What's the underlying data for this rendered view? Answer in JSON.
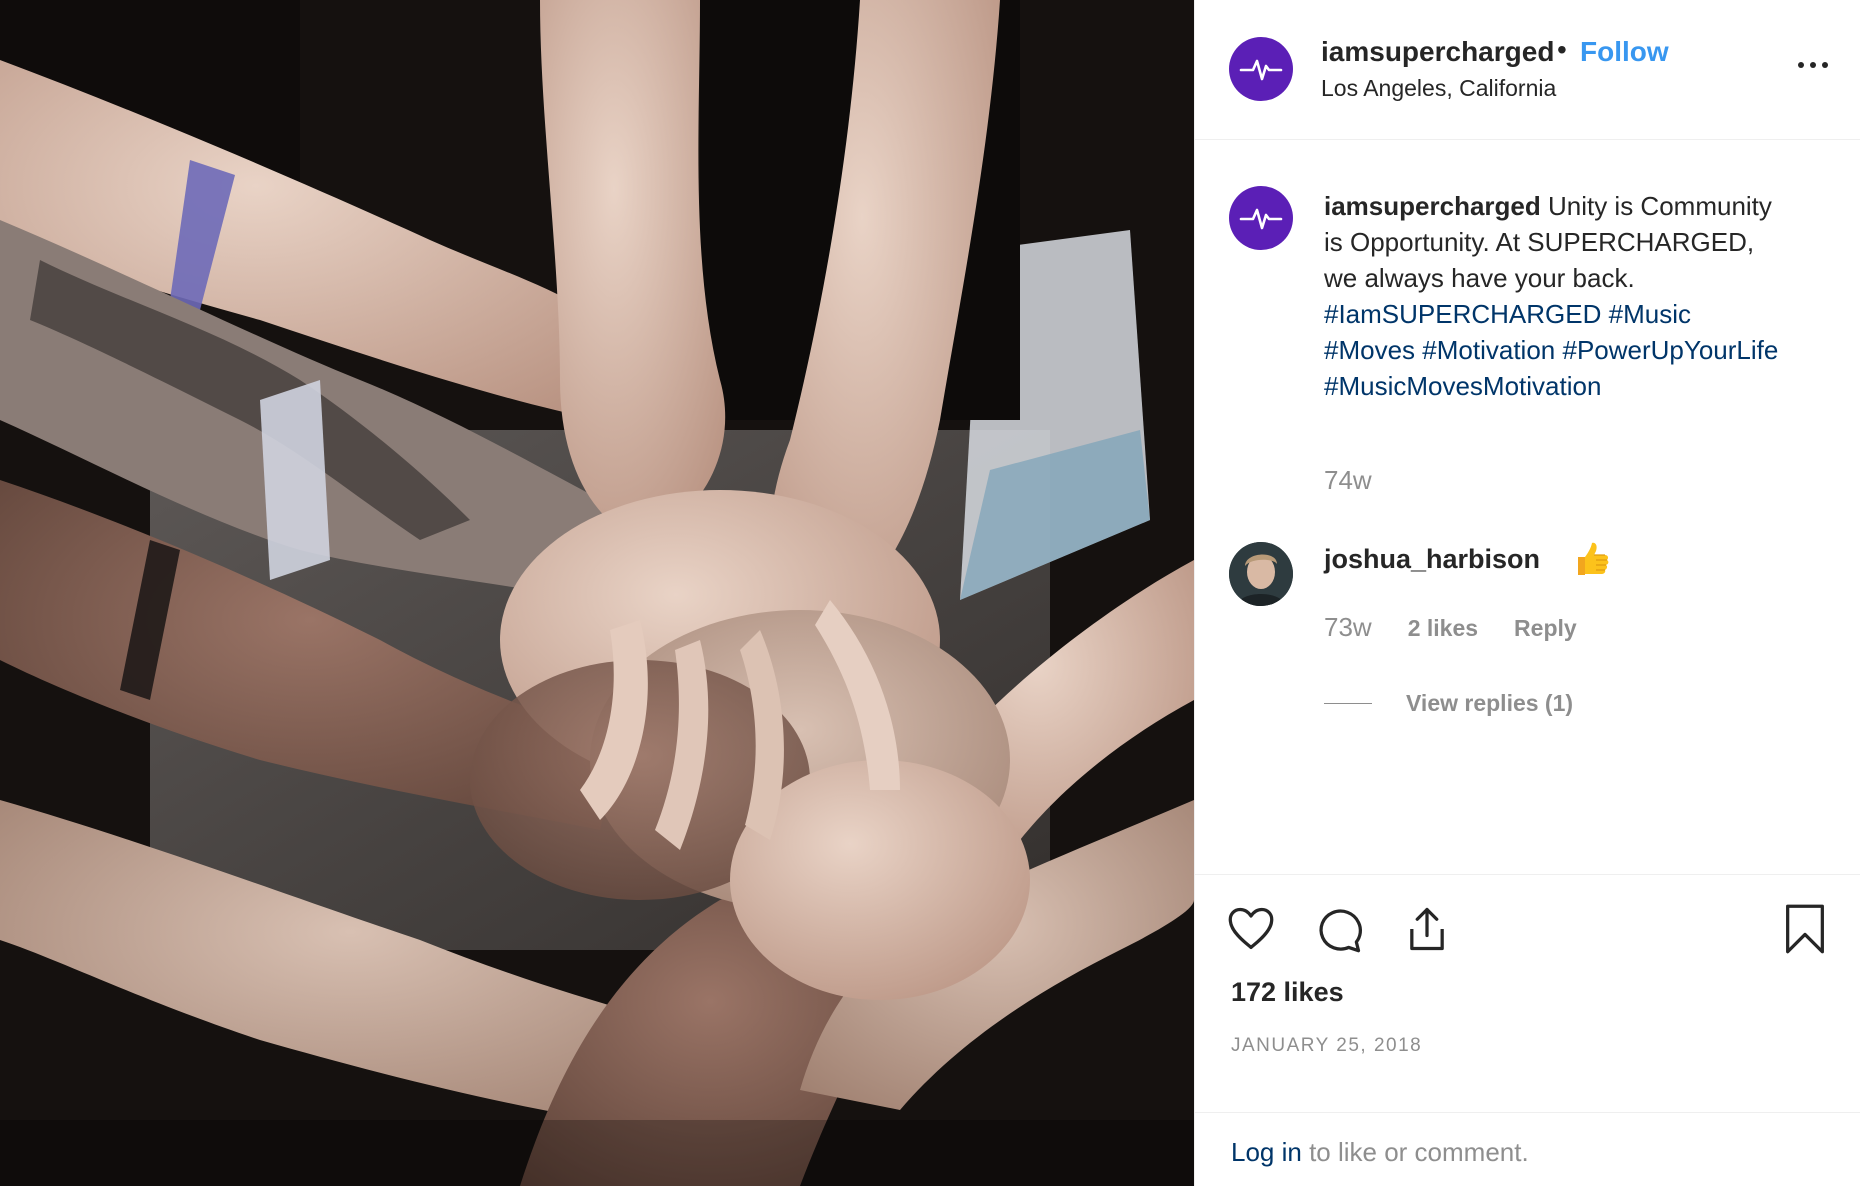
{
  "post": {
    "username": "iamsupercharged",
    "separator": "•",
    "follow_label": "Follow",
    "location": "Los Angeles, California",
    "brand_color": "#5b1fb6",
    "avatar_icon": "heartbeat-icon",
    "media_description_icon": "stacked-hands-photo"
  },
  "caption": {
    "username": "iamsupercharged",
    "text": " Unity is Community is Opportunity. At SUPERCHARGED, we always have your back. ",
    "hashtags": [
      "#IamSUPERCHARGED",
      "#Music",
      "#Moves",
      "#Motivation",
      "#PowerUpYourLife",
      "#MusicMovesMotivation"
    ],
    "time": "74w"
  },
  "comment": {
    "username": "joshua_harbison",
    "emoji": "thumbs-up",
    "time": "73w",
    "likes": "2 likes",
    "reply_label": "Reply",
    "view_replies": "View replies (1)"
  },
  "actions": {
    "likes": "172 likes",
    "date": "JANUARY 25, 2018"
  },
  "footer": {
    "login_link": "Log in",
    "login_rest": " to like or comment."
  }
}
